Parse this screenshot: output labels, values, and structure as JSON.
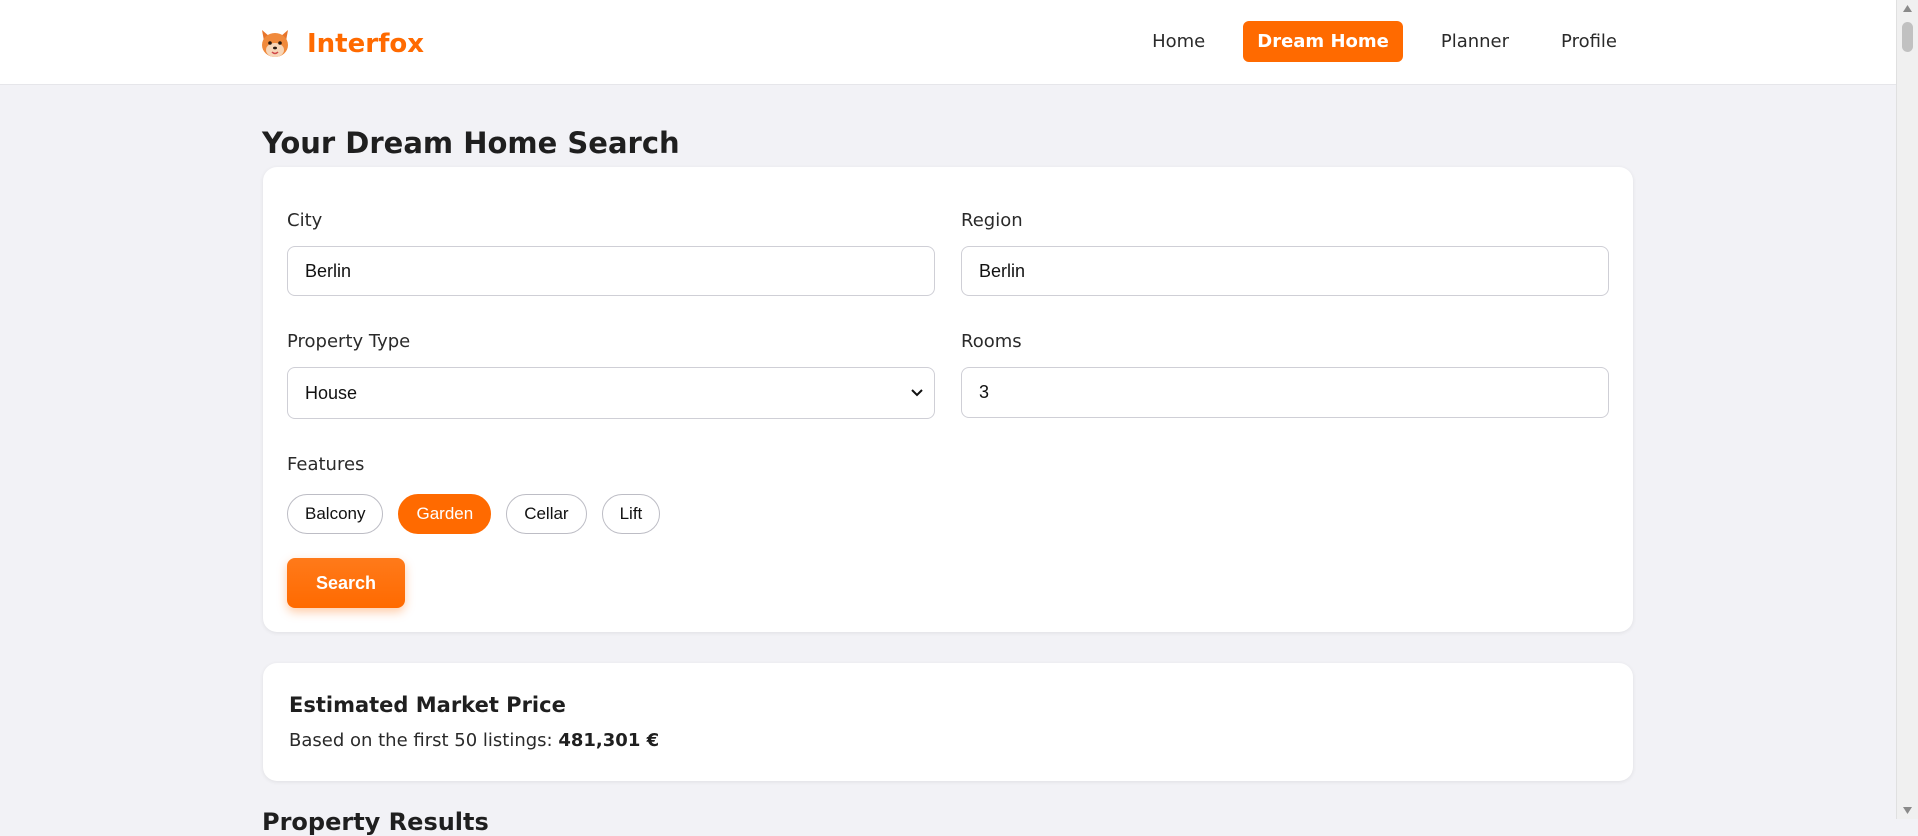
{
  "app": {
    "name": "Interfox",
    "brand_color": "#ff6a00",
    "logo_icon": "fox-icon"
  },
  "nav": {
    "items": [
      {
        "label": "Home",
        "active": false
      },
      {
        "label": "Dream Home",
        "active": true
      },
      {
        "label": "Planner",
        "active": false
      },
      {
        "label": "Profile",
        "active": false
      }
    ]
  },
  "page": {
    "title": "Your Dream Home Search"
  },
  "form": {
    "city": {
      "label": "City",
      "value": "Berlin"
    },
    "region": {
      "label": "Region",
      "value": "Berlin"
    },
    "property_type": {
      "label": "Property Type",
      "value": "House"
    },
    "rooms": {
      "label": "Rooms",
      "value": "3"
    },
    "features": {
      "label": "Features",
      "options": [
        {
          "label": "Balcony",
          "selected": false
        },
        {
          "label": "Garden",
          "selected": true
        },
        {
          "label": "Cellar",
          "selected": false
        },
        {
          "label": "Lift",
          "selected": false
        }
      ]
    },
    "search_label": "Search"
  },
  "estimate": {
    "title": "Estimated Market Price",
    "prefix": "Based on the first 50 listings:",
    "value": "481,301 €"
  },
  "next_section": {
    "title": "Property Results"
  }
}
